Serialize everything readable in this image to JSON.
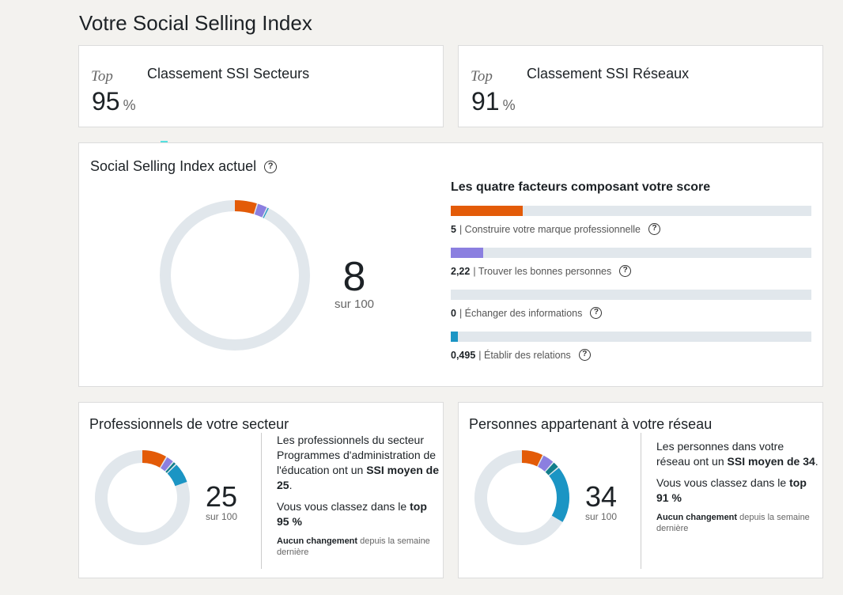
{
  "page": {
    "title": "Votre Social Selling Index"
  },
  "colors": {
    "orange": "#e35b08",
    "purple": "#8b7fe0",
    "teal": "#127e8c",
    "blue": "#1b95c4",
    "track": "#e1e7ec"
  },
  "ranks": [
    {
      "top_label": "Top",
      "value": "95",
      "unit": "%",
      "title": "Classement SSI Secteurs"
    },
    {
      "top_label": "Top",
      "value": "91",
      "unit": "%",
      "title": "Classement SSI Réseaux"
    }
  ],
  "ssi": {
    "title": "Social Selling Index actuel",
    "score": "8",
    "score_sub": "sur 100",
    "factors_title": "Les quatre facteurs composant votre score",
    "factors": [
      {
        "value": "5",
        "label": "| Construire votre marque professionnelle",
        "fraction": 0.2,
        "color": "#e35b08"
      },
      {
        "value": "2,22",
        "label": "| Trouver les bonnes personnes",
        "fraction": 0.089,
        "color": "#8b7fe0"
      },
      {
        "value": "0",
        "label": "| Échanger des informations",
        "fraction": 0,
        "color": "#127e8c"
      },
      {
        "value": "0,495",
        "label": "| Établir des relations",
        "fraction": 0.02,
        "color": "#1b95c4"
      }
    ],
    "donut": [
      5,
      2.22,
      0,
      0.495
    ]
  },
  "sector": {
    "title": "Professionnels de votre secteur",
    "score": "25",
    "score_sub": "sur 100",
    "desc_pre": "Les professionnels du secteur Programmes d'administration de l'éducation ont un ",
    "desc_bold": "SSI moyen de 25",
    "desc_post": ".",
    "rank_pre": "Vous vous classez dans le ",
    "rank_bold": "top 95 %",
    "change_bold": "Aucun changement",
    "change_rest": " depuis la semaine dernière",
    "donut": [
      8.8,
      2.8,
      1.2,
      7.2
    ]
  },
  "network": {
    "title": "Personnes appartenant à votre réseau",
    "score": "34",
    "score_sub": "sur 100",
    "desc_pre": "Les personnes dans votre réseau ont un ",
    "desc_bold": "SSI moyen de 34",
    "desc_post": ".",
    "rank_pre": "Vous vous classez dans le ",
    "rank_bold": "top 91 %",
    "change_bold": "Aucun changement",
    "change_rest": " depuis la semaine dernière",
    "donut": [
      7.6,
      4.2,
      2.4,
      19.8
    ]
  }
}
